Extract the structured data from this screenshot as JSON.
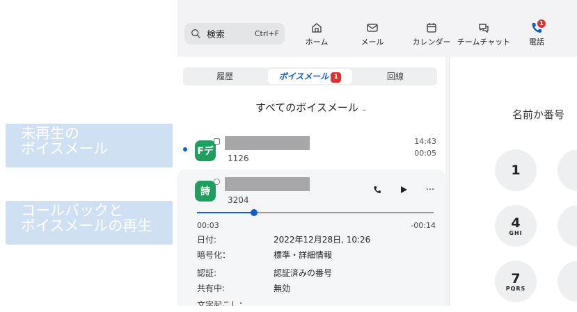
{
  "callouts": {
    "unplayed": [
      "未再生の",
      "ボイスメール"
    ],
    "callback": [
      "コールバックと",
      "ボイスメールの再生"
    ]
  },
  "search": {
    "label": "検索",
    "shortcut": "Ctrl+F"
  },
  "nav": {
    "home": "ホーム",
    "mail": "メール",
    "calendar": "カレンダー",
    "chat": "チームチャット",
    "phone": "電話",
    "phone_badge": "1"
  },
  "tabs": {
    "history": "履歴",
    "voicemail": "ボイスメール",
    "voicemail_badge": "1",
    "lines": "回線"
  },
  "filter": "すべてのボイスメール",
  "voicemails": [
    {
      "avatar": "Fデ",
      "ext": "1126",
      "time": "14:43",
      "duration": "00:05",
      "unread": true
    },
    {
      "avatar": "詩",
      "ext": "3204"
    }
  ],
  "player": {
    "elapsed": "00:03",
    "remaining": "-00:14",
    "progress_fraction": 0.24
  },
  "details": {
    "date_label": "日付:",
    "date_value": "2022年12月28日, 10:26",
    "enc_label": "暗号化：",
    "enc_value": "標準・詳細情報",
    "auth_label": "認証:",
    "auth_value": "認証済みの番号",
    "share_label": "共有中:",
    "share_value": "無効",
    "transcript_label": "文字起こし："
  },
  "dialpad": {
    "search_placeholder": "名前か番号",
    "keys": [
      {
        "num": "1",
        "letters": ""
      },
      {
        "num": "4",
        "letters": "GHI"
      },
      {
        "num": "7",
        "letters": "PQRS"
      }
    ]
  }
}
